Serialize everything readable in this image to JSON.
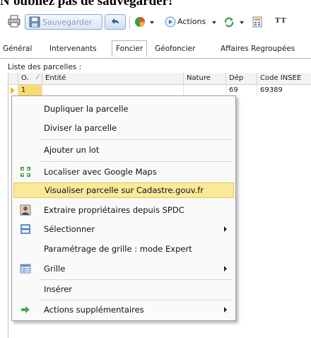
{
  "heading": "N'oubliez pas de sauvegarder!",
  "toolbar": {
    "save_label": "Sauvegarder",
    "actions_label": "Actions",
    "text_label": "TT"
  },
  "tabs": [
    {
      "label": "Général"
    },
    {
      "label": "Intervenants"
    },
    {
      "label": "Foncier"
    },
    {
      "label": "Géofoncier"
    },
    {
      "label": "Affaires Regroupées"
    }
  ],
  "parcel_list": {
    "title": "Liste des parcelles :",
    "columns": [
      "O.",
      "Entité",
      "Nature",
      "Dép",
      "Code INSEE"
    ],
    "rows": [
      {
        "order": "1",
        "entite": "",
        "nature": "",
        "dep": "69",
        "code_insee": "69389"
      }
    ]
  },
  "context_menu": {
    "items": [
      {
        "label": "Dupliquer la parcelle",
        "icon": "none",
        "submenu": false
      },
      {
        "label": "Diviser la parcelle",
        "icon": "none",
        "submenu": false
      },
      {
        "label": "Ajouter un lot",
        "icon": "none",
        "submenu": false
      },
      {
        "label": "Localiser avec Google Maps",
        "icon": "locate-icon",
        "submenu": false
      },
      {
        "label": "Visualiser parcelle sur Cadastre.gouv.fr",
        "icon": "none",
        "submenu": false,
        "highlighted": true
      },
      {
        "label": "Extraire propriétaires depuis SPDC",
        "icon": "owner-icon",
        "submenu": false
      },
      {
        "label": "Sélectionner",
        "icon": "select-icon",
        "submenu": true
      },
      {
        "label": "Paramétrage de grille : mode Expert",
        "icon": "none",
        "submenu": false
      },
      {
        "label": "Grille",
        "icon": "grid-icon",
        "submenu": true
      },
      {
        "label": "Insérer",
        "icon": "none",
        "submenu": false
      },
      {
        "label": "Actions supplémentaires",
        "icon": "arrow-right-icon",
        "submenu": true
      }
    ]
  },
  "colors": {
    "highlight": "#fbe99a",
    "highlight_border": "#e7c553",
    "row_indicator": "#e7bc2b",
    "toolbar_border": "#86a8d0"
  }
}
